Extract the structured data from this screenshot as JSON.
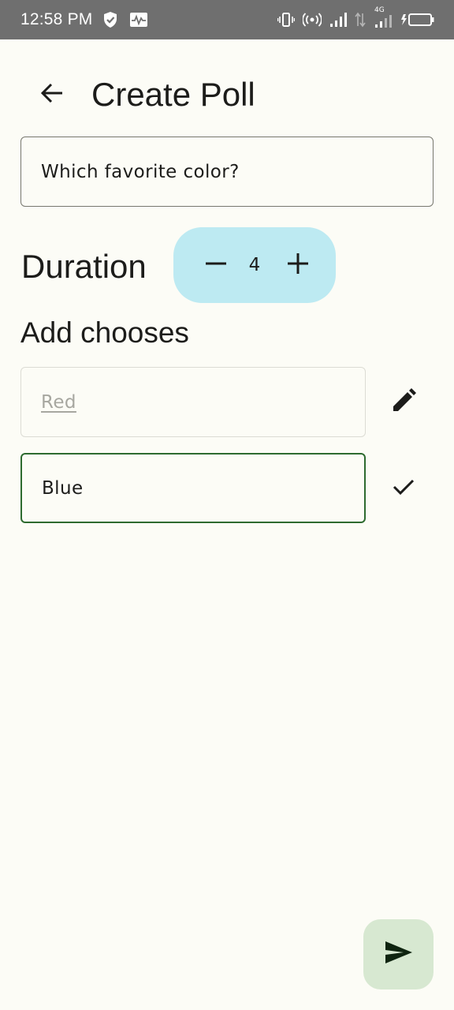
{
  "status_bar": {
    "time": "12:58 PM",
    "network_label": "4G",
    "icons": [
      "shield-check-icon",
      "activity-icon",
      "vibrate-icon",
      "hotspot-icon",
      "signal-icon",
      "data-transfer-icon",
      "signal-4g-icon",
      "battery-charging-icon"
    ]
  },
  "app_bar": {
    "title": "Create Poll",
    "back_icon": "arrow-back-icon"
  },
  "question": {
    "value": "Which favorite color?"
  },
  "duration": {
    "label": "Duration",
    "value": "4",
    "minus_icon": "minus-icon",
    "plus_icon": "plus-icon"
  },
  "choices": {
    "title": "Add chooses",
    "items": [
      {
        "value": "Red",
        "state": "saved",
        "action_icon": "pencil-icon"
      },
      {
        "value": "Blue",
        "state": "editing",
        "action_icon": "check-icon"
      }
    ]
  },
  "fab": {
    "icon": "send-icon"
  },
  "colors": {
    "background": "#fcfcf6",
    "status_bar": "#6f6f6f",
    "stepper_bg": "#bdeaf2",
    "active_border": "#2e6b30",
    "fab_bg": "#d7e8d1",
    "disabled_text": "#a7a7a0"
  }
}
